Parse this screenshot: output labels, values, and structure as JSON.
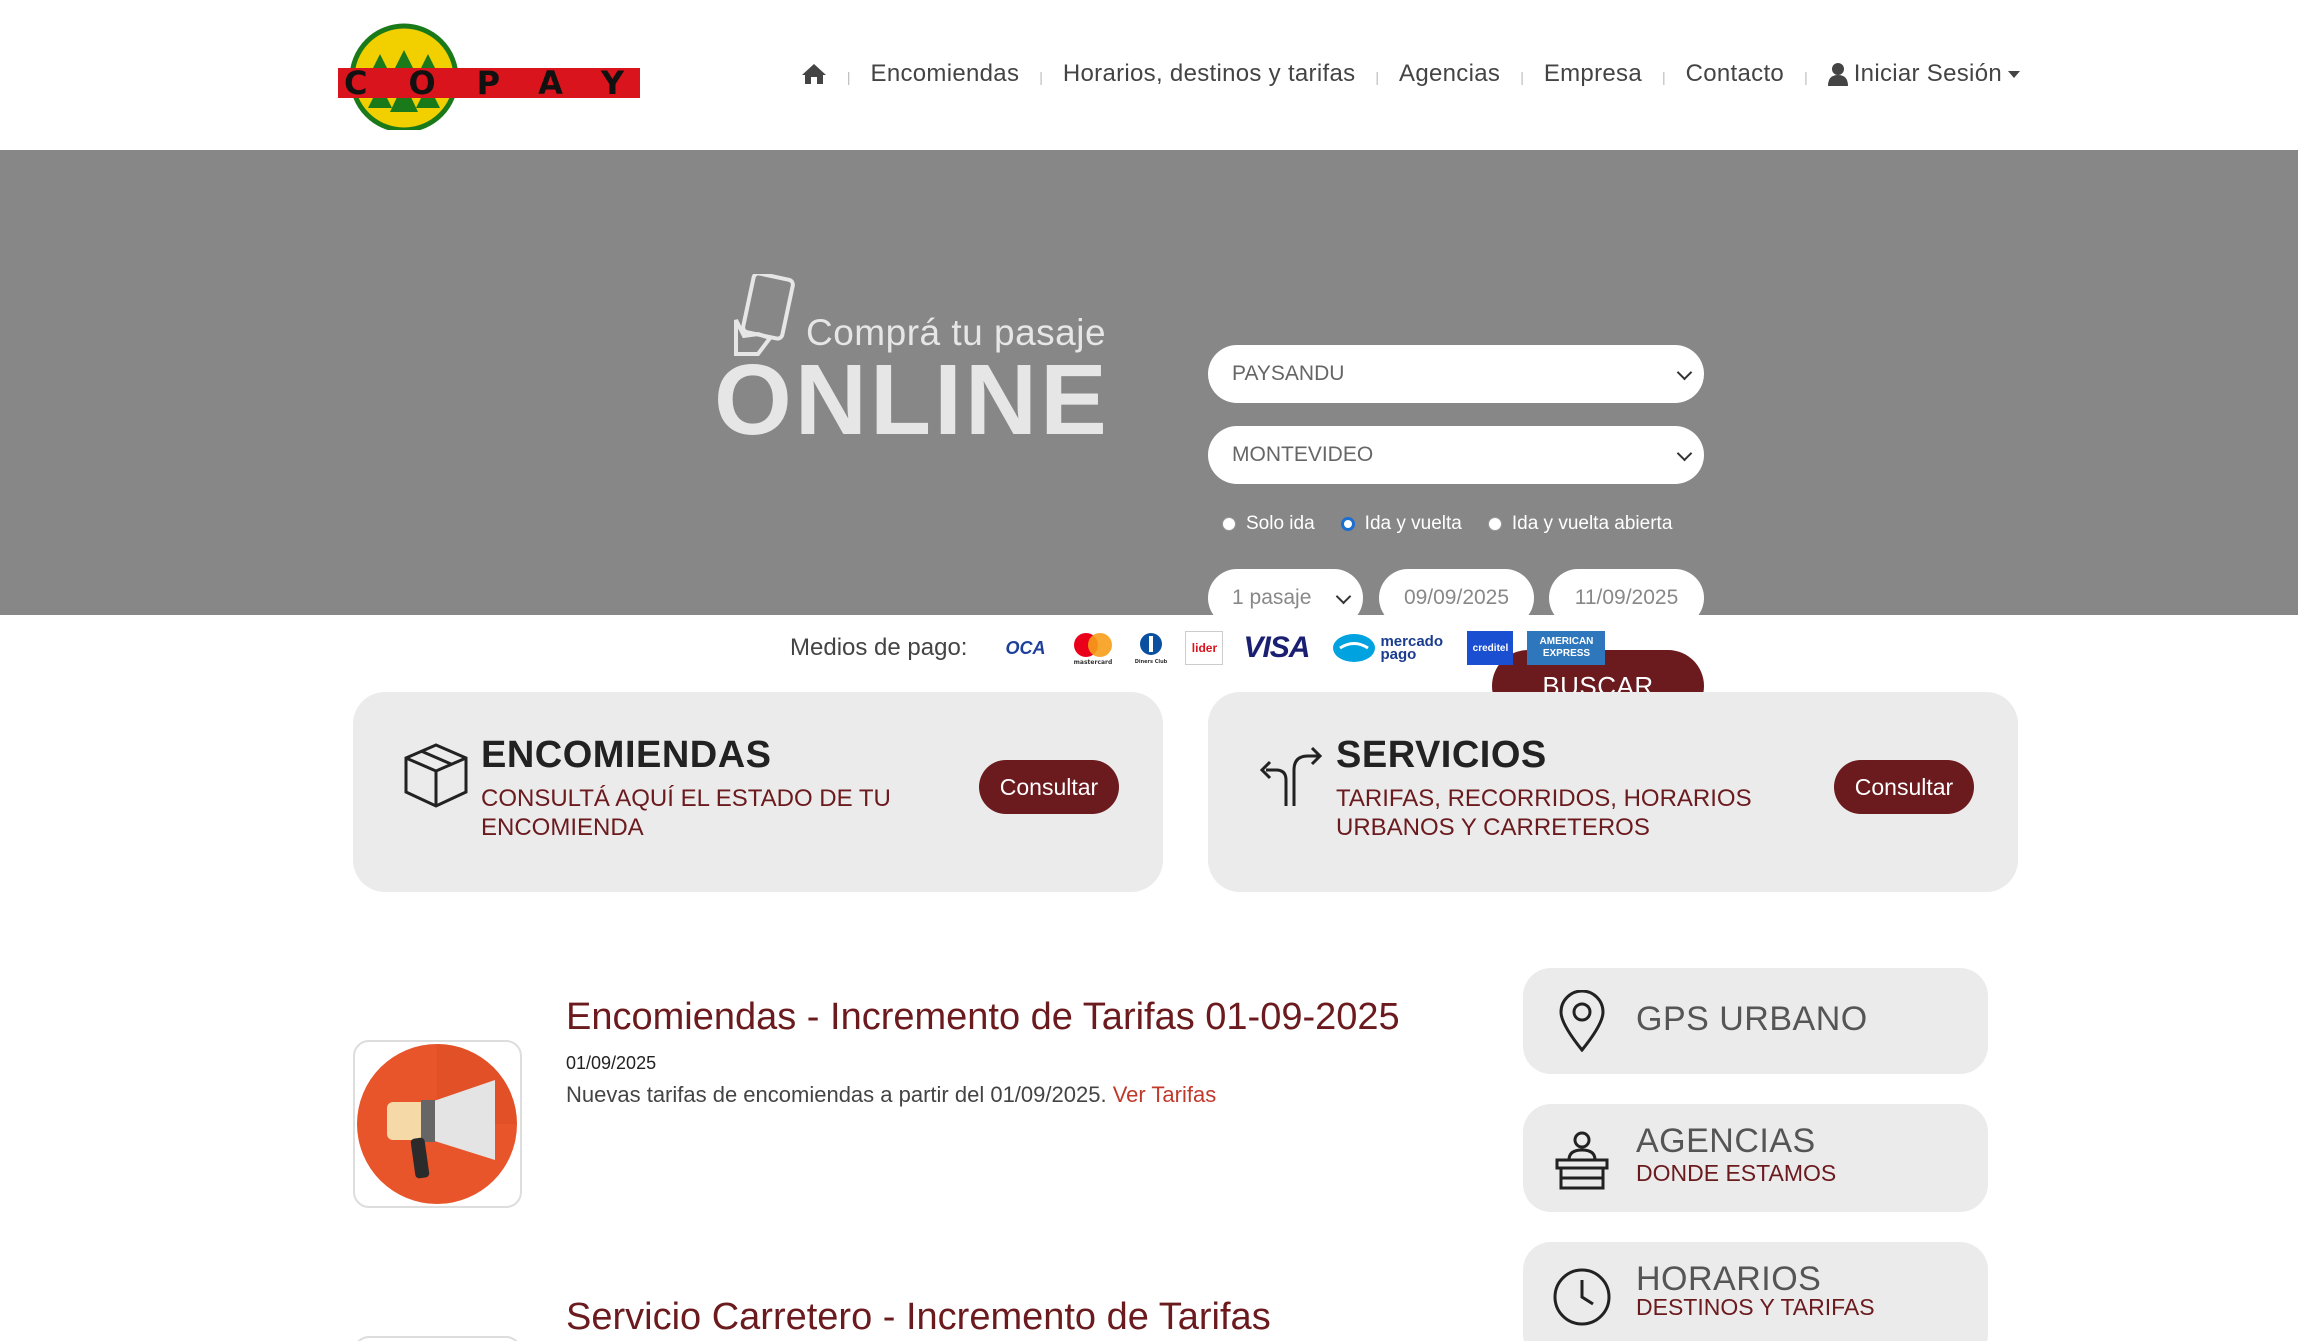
{
  "brand": {
    "logo_text": "COPAY"
  },
  "nav": {
    "home_label": "",
    "items": [
      "Encomiendas",
      "Horarios, destinos y tarifas",
      "Agencias",
      "Empresa",
      "Contacto"
    ],
    "login_label": "Iniciar Sesión"
  },
  "hero": {
    "promo_line1": "Comprá tu pasaje",
    "promo_line2": "ONLINE",
    "origin": "PAYSANDU",
    "destination": "MONTEVIDEO",
    "trip_types": [
      "Solo ida",
      "Ida y vuelta",
      "Ida y vuelta abierta"
    ],
    "selected_trip_type": "Ida y vuelta",
    "passengers": "1 pasaje",
    "date_out": "09/09/2025",
    "date_return": "11/09/2025",
    "search_label": "BUSCAR"
  },
  "payments": {
    "label": "Medios de pago:",
    "methods": [
      "OCA",
      "mastercard",
      "Diners Club",
      "lider",
      "VISA",
      "mercado pago",
      "creditel",
      "AMERICAN EXPRESS"
    ]
  },
  "cards": [
    {
      "title": "ENCOMIENDAS",
      "subtitle": "CONSULTÁ AQUÍ EL ESTADO DE TU ENCOMIENDA",
      "button": "Consultar"
    },
    {
      "title": "SERVICIOS",
      "subtitle": "TARIFAS, RECORRIDOS, HORARIOS URBANOS Y CARRETEROS",
      "button": "Consultar"
    }
  ],
  "news": [
    {
      "title": "Encomiendas - Incremento de Tarifas 01-09-2025",
      "date": "01/09/2025",
      "text": "Nuevas tarifas de encomiendas a partir del 01/09/2025.",
      "link": "Ver Tarifas"
    },
    {
      "title": "Servicio Carretero - Incremento de Tarifas"
    }
  ],
  "side": [
    {
      "title": "GPS URBANO",
      "subtitle": ""
    },
    {
      "title": "AGENCIAS",
      "subtitle": "DONDE ESTAMOS"
    },
    {
      "title": "HORARIOS",
      "subtitle": "DESTINOS Y TARIFAS"
    }
  ],
  "colors": {
    "brand": "#6b1a1e",
    "hero_bg": "#878787",
    "card_bg": "#ebebeb"
  }
}
